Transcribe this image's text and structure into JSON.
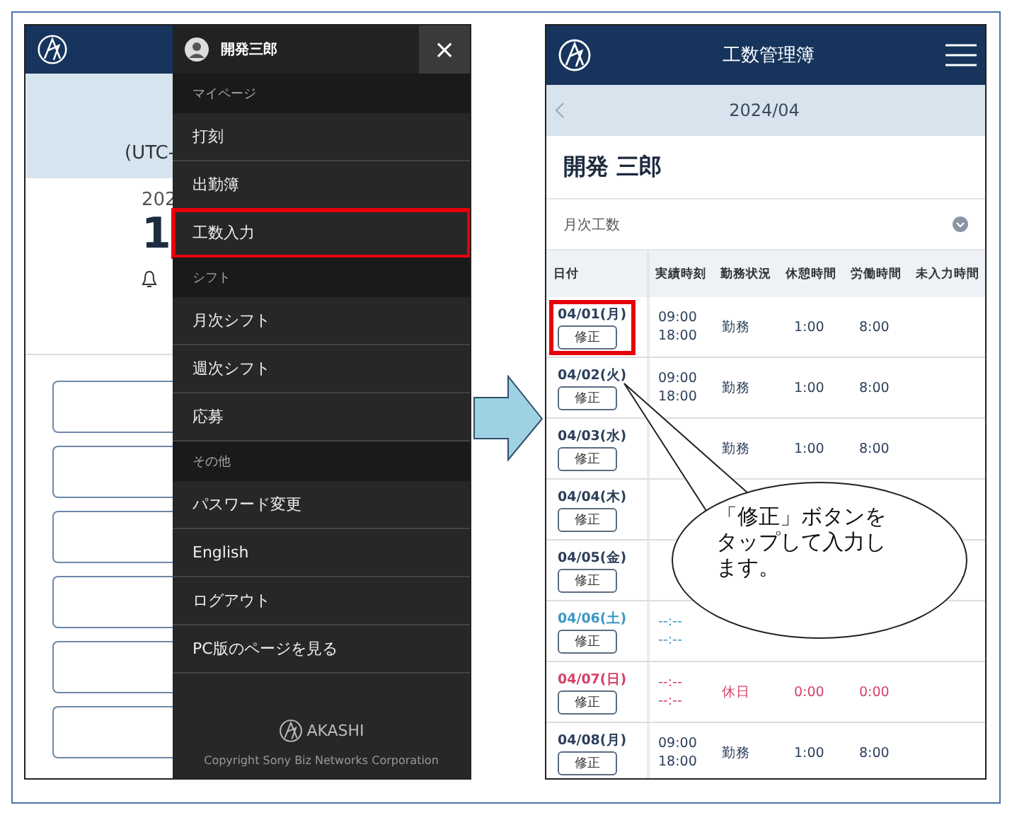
{
  "left_screen": {
    "background": {
      "timezone": "(UTC-",
      "date": "202",
      "time": "1",
      "blank_buttons": [
        {
          "kind": "outlined"
        },
        {
          "kind": "outlined"
        },
        {
          "kind": "outlined"
        },
        {
          "kind": "outlined"
        },
        {
          "kind": "outlined"
        },
        {
          "kind": "outlined"
        }
      ]
    },
    "menu": {
      "user_name": "開発三郎",
      "close": "×",
      "sections": [
        {
          "title": "マイページ",
          "items": [
            {
              "label": "打刻",
              "highlighted": false
            },
            {
              "label": "出勤簿",
              "highlighted": false
            },
            {
              "label": "工数入力",
              "highlighted": true
            }
          ]
        },
        {
          "title": "シフト",
          "items": [
            {
              "label": "月次シフト",
              "highlighted": false
            },
            {
              "label": "週次シフト",
              "highlighted": false
            },
            {
              "label": "応募",
              "highlighted": false
            }
          ]
        },
        {
          "title": "その他",
          "items": [
            {
              "label": "パスワード変更",
              "highlighted": false
            },
            {
              "label": "English",
              "highlighted": false
            },
            {
              "label": "ログアウト",
              "highlighted": false
            },
            {
              "label": "PC版のページを見る",
              "highlighted": false
            }
          ]
        }
      ],
      "footer": {
        "logo_text": "AKASHI",
        "copyright": "Copyright Sony Biz Networks Corporation"
      }
    }
  },
  "right_screen": {
    "title": "工数管理簿",
    "month": "2024/04",
    "employee_name": "開発 三郎",
    "summary_label": "月次工数",
    "columns": [
      "日付",
      "実績時刻",
      "勤務状況",
      "休憩時間",
      "労働時間",
      "未入力時間"
    ],
    "rows": [
      {
        "date": "04/01(月)",
        "color": "#2b3f5a",
        "button": "修正",
        "highlighted": true,
        "times": [
          "09:00",
          "18:00"
        ],
        "status": "勤務",
        "break": "1:00",
        "work": "8:00"
      },
      {
        "date": "04/02(火)",
        "color": "#2b3f5a",
        "button": "修正",
        "highlighted": false,
        "times": [
          "09:00",
          "18:00"
        ],
        "status": "勤務",
        "break": "1:00",
        "work": "8:00"
      },
      {
        "date": "04/03(水)",
        "color": "#2b3f5a",
        "button": "修正",
        "highlighted": false,
        "status": "勤務",
        "break": "1:00",
        "work": "8:00"
      },
      {
        "date": "04/04(木)",
        "color": "#2b3f5a",
        "button": "修正",
        "highlighted": false
      },
      {
        "date": "04/05(金)",
        "color": "#2b3f5a",
        "button": "修正",
        "highlighted": false
      },
      {
        "date": "04/06(土)",
        "color": "#3a98c4",
        "button": "修正",
        "highlighted": false,
        "times": [
          "--:--",
          "--:--"
        ]
      },
      {
        "date": "04/07(日)",
        "color": "#d6406a",
        "button": "修正",
        "highlighted": false,
        "times": [
          "--:--",
          "--:--"
        ],
        "status": "休日",
        "break": "0:00",
        "work": "0:00"
      },
      {
        "date": "04/08(月)",
        "color": "#2b3f5a",
        "button": "修正",
        "highlighted": false,
        "times": [
          "09:00",
          "18:00"
        ],
        "status": "勤務",
        "break": "1:00",
        "work": "8:00"
      }
    ]
  },
  "callout": {
    "text": "「修正」ボタンをタップして入力します。"
  }
}
